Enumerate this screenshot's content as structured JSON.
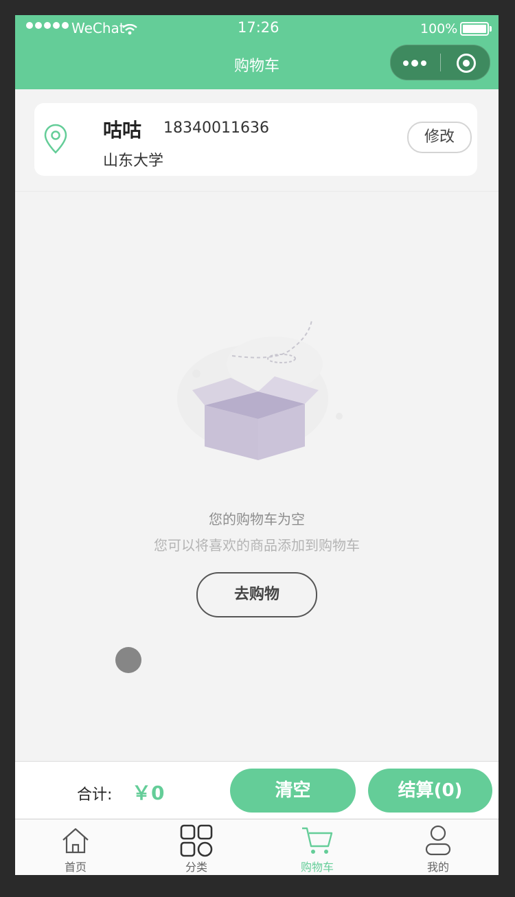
{
  "status_bar": {
    "carrier": "WeChat",
    "time": "17:26",
    "battery": "100%"
  },
  "nav": {
    "title": "购物车"
  },
  "address": {
    "name": "咕咕",
    "phone": "18340011636",
    "place": "山东大学",
    "modify_label": "修改"
  },
  "empty_state": {
    "title": "您的购物车为空",
    "subtitle": "您可以将喜欢的商品添加到购物车",
    "go_shopping_label": "去购物"
  },
  "checkout": {
    "total_label": "合计:",
    "total_value": "￥0",
    "clear_label": "清空",
    "checkout_label": "结算(0)"
  },
  "tabs": [
    {
      "label": "首页",
      "icon": "home-icon"
    },
    {
      "label": "分类",
      "icon": "category-icon"
    },
    {
      "label": "购物车",
      "icon": "cart-icon",
      "active": true
    },
    {
      "label": "我的",
      "icon": "user-icon"
    }
  ],
  "colors": {
    "brand": "#64cd98",
    "capsule": "#3e8a5f",
    "background": "#f3f3f3"
  }
}
